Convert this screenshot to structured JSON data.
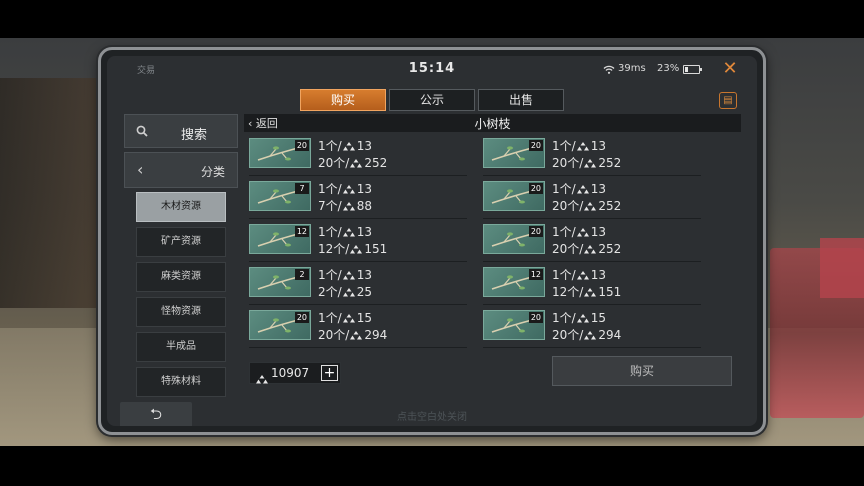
{
  "status": {
    "app": "交易",
    "time": "15:14",
    "ping": "39ms",
    "battery": "23%",
    "battery_level": 0.23
  },
  "tabs": [
    {
      "label": "购买",
      "active": true
    },
    {
      "label": "公示",
      "active": false
    },
    {
      "label": "出售",
      "active": false
    }
  ],
  "sidebar": {
    "search_label": "搜索",
    "category_header": "分类",
    "categories": [
      {
        "label": "木材资源",
        "active": true
      },
      {
        "label": "矿产资源",
        "active": false
      },
      {
        "label": "麻类资源",
        "active": false
      },
      {
        "label": "怪物资源",
        "active": false
      },
      {
        "label": "半成品",
        "active": false
      },
      {
        "label": "特殊材料",
        "active": false
      }
    ]
  },
  "panel": {
    "back_label": "返回",
    "title": "小树枝"
  },
  "listings": [
    {
      "qty": "20",
      "unit_prefix": "1个/",
      "unit_price": "13",
      "total_prefix": "20个/",
      "total_price": "252"
    },
    {
      "qty": "20",
      "unit_prefix": "1个/",
      "unit_price": "13",
      "total_prefix": "20个/",
      "total_price": "252"
    },
    {
      "qty": "7",
      "unit_prefix": "1个/",
      "unit_price": "13",
      "total_prefix": "7个/",
      "total_price": "88"
    },
    {
      "qty": "20",
      "unit_prefix": "1个/",
      "unit_price": "13",
      "total_prefix": "20个/",
      "total_price": "252"
    },
    {
      "qty": "12",
      "unit_prefix": "1个/",
      "unit_price": "13",
      "total_prefix": "12个/",
      "total_price": "151"
    },
    {
      "qty": "20",
      "unit_prefix": "1个/",
      "unit_price": "13",
      "total_prefix": "20个/",
      "total_price": "252"
    },
    {
      "qty": "2",
      "unit_prefix": "1个/",
      "unit_price": "13",
      "total_prefix": "2个/",
      "total_price": "25"
    },
    {
      "qty": "12",
      "unit_prefix": "1个/",
      "unit_price": "13",
      "total_prefix": "12个/",
      "total_price": "151"
    },
    {
      "qty": "20",
      "unit_prefix": "1个/",
      "unit_price": "15",
      "total_prefix": "20个/",
      "total_price": "294"
    },
    {
      "qty": "20",
      "unit_prefix": "1个/",
      "unit_price": "15",
      "total_prefix": "20个/",
      "total_price": "294"
    }
  ],
  "balance": {
    "value": "10907",
    "add_label": "+"
  },
  "buy_label": "购买",
  "footer_hint": "点击空白处关闭",
  "close_label": "✕",
  "colors": {
    "accent": "#d77d2e",
    "panel": "#2c2f32",
    "thumb": "#5c8c80"
  },
  "icons": {
    "currency": "coin-icon",
    "search": "search-icon",
    "wifi": "wifi-icon",
    "clipboard": "clipboard-icon",
    "back": "undo-arrow-icon"
  }
}
